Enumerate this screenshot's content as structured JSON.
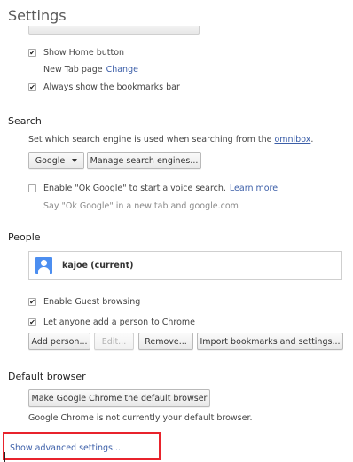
{
  "page": {
    "title": "Settings"
  },
  "appearance": {
    "show_home_button": {
      "label": "Show Home button",
      "checked": true
    },
    "home_page": {
      "text": "New Tab page",
      "change_link": "Change"
    },
    "bookmarks_bar": {
      "label": "Always show the bookmarks bar",
      "checked": true
    }
  },
  "search": {
    "title": "Search",
    "description": "Set which search engine is used when searching from the",
    "omnibox_link": "omnibox",
    "description_end": ".",
    "engine_select": "Google",
    "manage_button": "Manage search engines...",
    "ok_google": {
      "label": "Enable \"Ok Google\" to start a voice search.",
      "learn_more": "Learn more",
      "checked": false
    },
    "ok_google_hint": "Say \"Ok Google\" in a new tab and google.com"
  },
  "people": {
    "title": "People",
    "profiles": [
      {
        "name": "kajoe (current)"
      }
    ],
    "guest_browsing": {
      "label": "Enable Guest browsing",
      "checked": true
    },
    "anyone_add": {
      "label": "Let anyone add a person to Chrome",
      "checked": true
    },
    "buttons": {
      "add": "Add person...",
      "edit": "Edit...",
      "remove": "Remove...",
      "import": "Import bookmarks and settings..."
    }
  },
  "default_browser": {
    "title": "Default browser",
    "make_default_button": "Make Google Chrome the default browser",
    "status": "Google Chrome is not currently your default browser."
  },
  "footer": {
    "advanced_link": "Show advanced settings..."
  },
  "colors": {
    "link": "#3b5ea8",
    "highlight_box": "#e8232c",
    "avatar": "#4c8ef0"
  }
}
